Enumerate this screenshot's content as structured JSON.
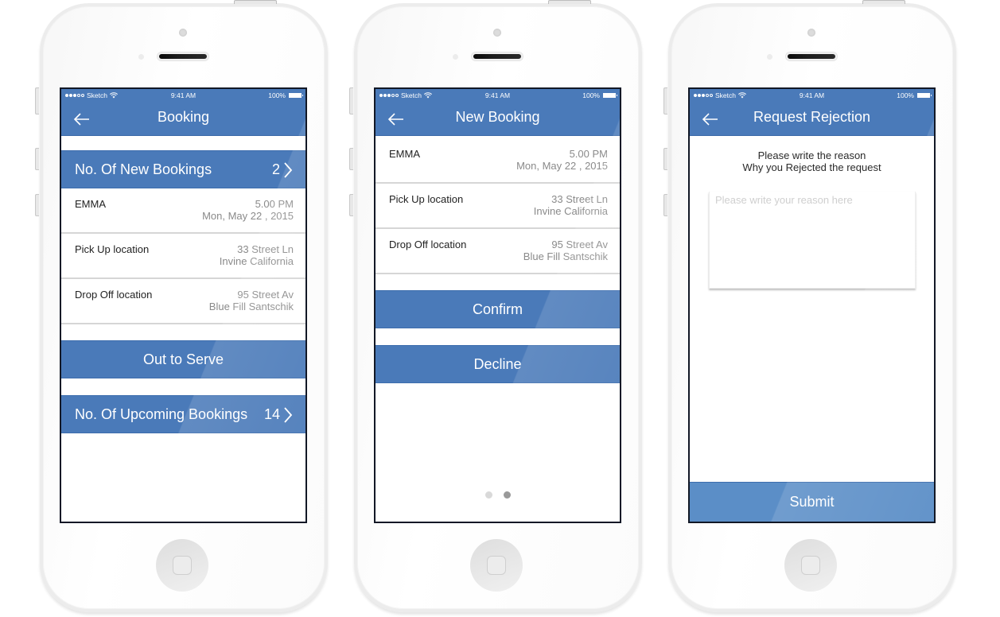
{
  "status_bar": {
    "carrier": "Sketch",
    "time": "9:41 AM",
    "battery": "100%",
    "signal_bars_filled": 3,
    "signal_bars_total": 5
  },
  "theme": {
    "primary": "#4a7ab9",
    "submit": "#5b8ec7",
    "text_dark": "#222222",
    "text_muted": "#8a8a8a"
  },
  "screens": [
    {
      "title": "Booking",
      "new_bookings": {
        "label": "No. Of New Bookings",
        "count": "2"
      },
      "booking": {
        "name": "EMMA",
        "time": "5.00 PM",
        "date": "Mon, May 22 , 2015",
        "pickup_label": "Pick Up location",
        "pickup_line1": "33 Street Ln",
        "pickup_line2": "Invine California",
        "dropoff_label": "Drop Off location",
        "dropoff_line1": "95 Street Av",
        "dropoff_line2": "Blue Fill Santschik"
      },
      "action_label": "Out to Serve",
      "upcoming_bookings": {
        "label": "No. Of Upcoming Bookings",
        "count": "14"
      }
    },
    {
      "title": "New Booking",
      "booking": {
        "name": "EMMA",
        "time": "5.00 PM",
        "date": "Mon, May 22 , 2015",
        "pickup_label": "Pick Up location",
        "pickup_line1": "33 Street Ln",
        "pickup_line2": "Invine California",
        "dropoff_label": "Drop Off location",
        "dropoff_line1": "95 Street Av",
        "dropoff_line2": "Blue Fill Santschik"
      },
      "confirm_label": "Confirm",
      "decline_label": "Decline",
      "pagination": {
        "current_page": 2,
        "total_pages": 2
      }
    },
    {
      "title": "Request Rejection",
      "prompt_line1": "Please write the reason",
      "prompt_line2": "Why you Rejected the request",
      "reason_placeholder": "Please write your reason here",
      "reason_value": "",
      "submit_label": "Submit"
    }
  ]
}
